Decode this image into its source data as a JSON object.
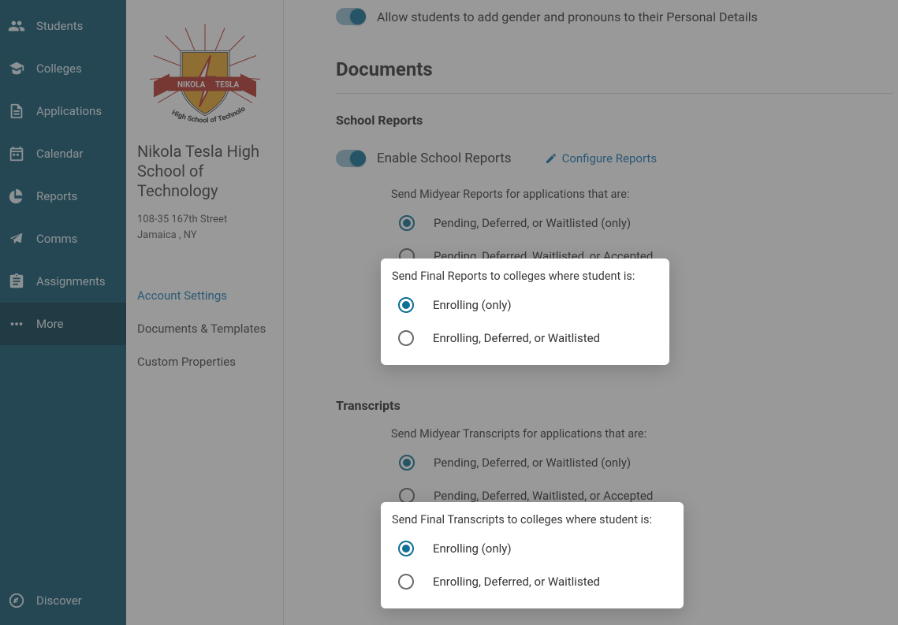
{
  "nav": {
    "students": "Students",
    "colleges": "Colleges",
    "applications": "Applications",
    "calendar": "Calendar",
    "reports": "Reports",
    "comms": "Comms",
    "assignments": "Assignments",
    "more": "More",
    "discover": "Discover"
  },
  "school": {
    "name": "Nikola Tesla High School of Technology",
    "addr1": "108-35 167th Street",
    "addr2": "Jamaica , NY",
    "ribbon_left": "NIKOLA",
    "ribbon_right": "TESLA",
    "motto": "High School of Technology"
  },
  "local_nav": {
    "account": "Account Settings",
    "docs": "Documents & Templates",
    "custom": "Custom Properties"
  },
  "content": {
    "pronouns_toggle": "Allow students to add gender and pronouns to their Personal Details",
    "documents_heading": "Documents",
    "school_reports_heading": "School Reports",
    "enable_reports": "Enable School Reports",
    "configure_reports": "Configure Reports",
    "midyear_reports_label": "Send Midyear Reports for applications that are:",
    "midyear_opt1": "Pending, Deferred, or Waitlisted (only)",
    "midyear_opt2": "Pending, Deferred, Waitlisted, or Accepted",
    "final_reports_label": "Send Final Reports to colleges where student is:",
    "final_opt1": "Enrolling (only)",
    "final_opt2": "Enrolling, Deferred, or Waitlisted",
    "transcripts_heading": "Transcripts",
    "midyear_transcripts_label": "Send Midyear Transcripts for applications that are:",
    "t_midyear_opt1": "Pending, Deferred, or Waitlisted (only)",
    "t_midyear_opt2": "Pending, Deferred, Waitlisted, or Accepted",
    "final_transcripts_label": "Send Final Transcripts to colleges where student is:",
    "t_final_opt1": "Enrolling (only)",
    "t_final_opt2": "Enrolling, Deferred, or Waitlisted"
  }
}
